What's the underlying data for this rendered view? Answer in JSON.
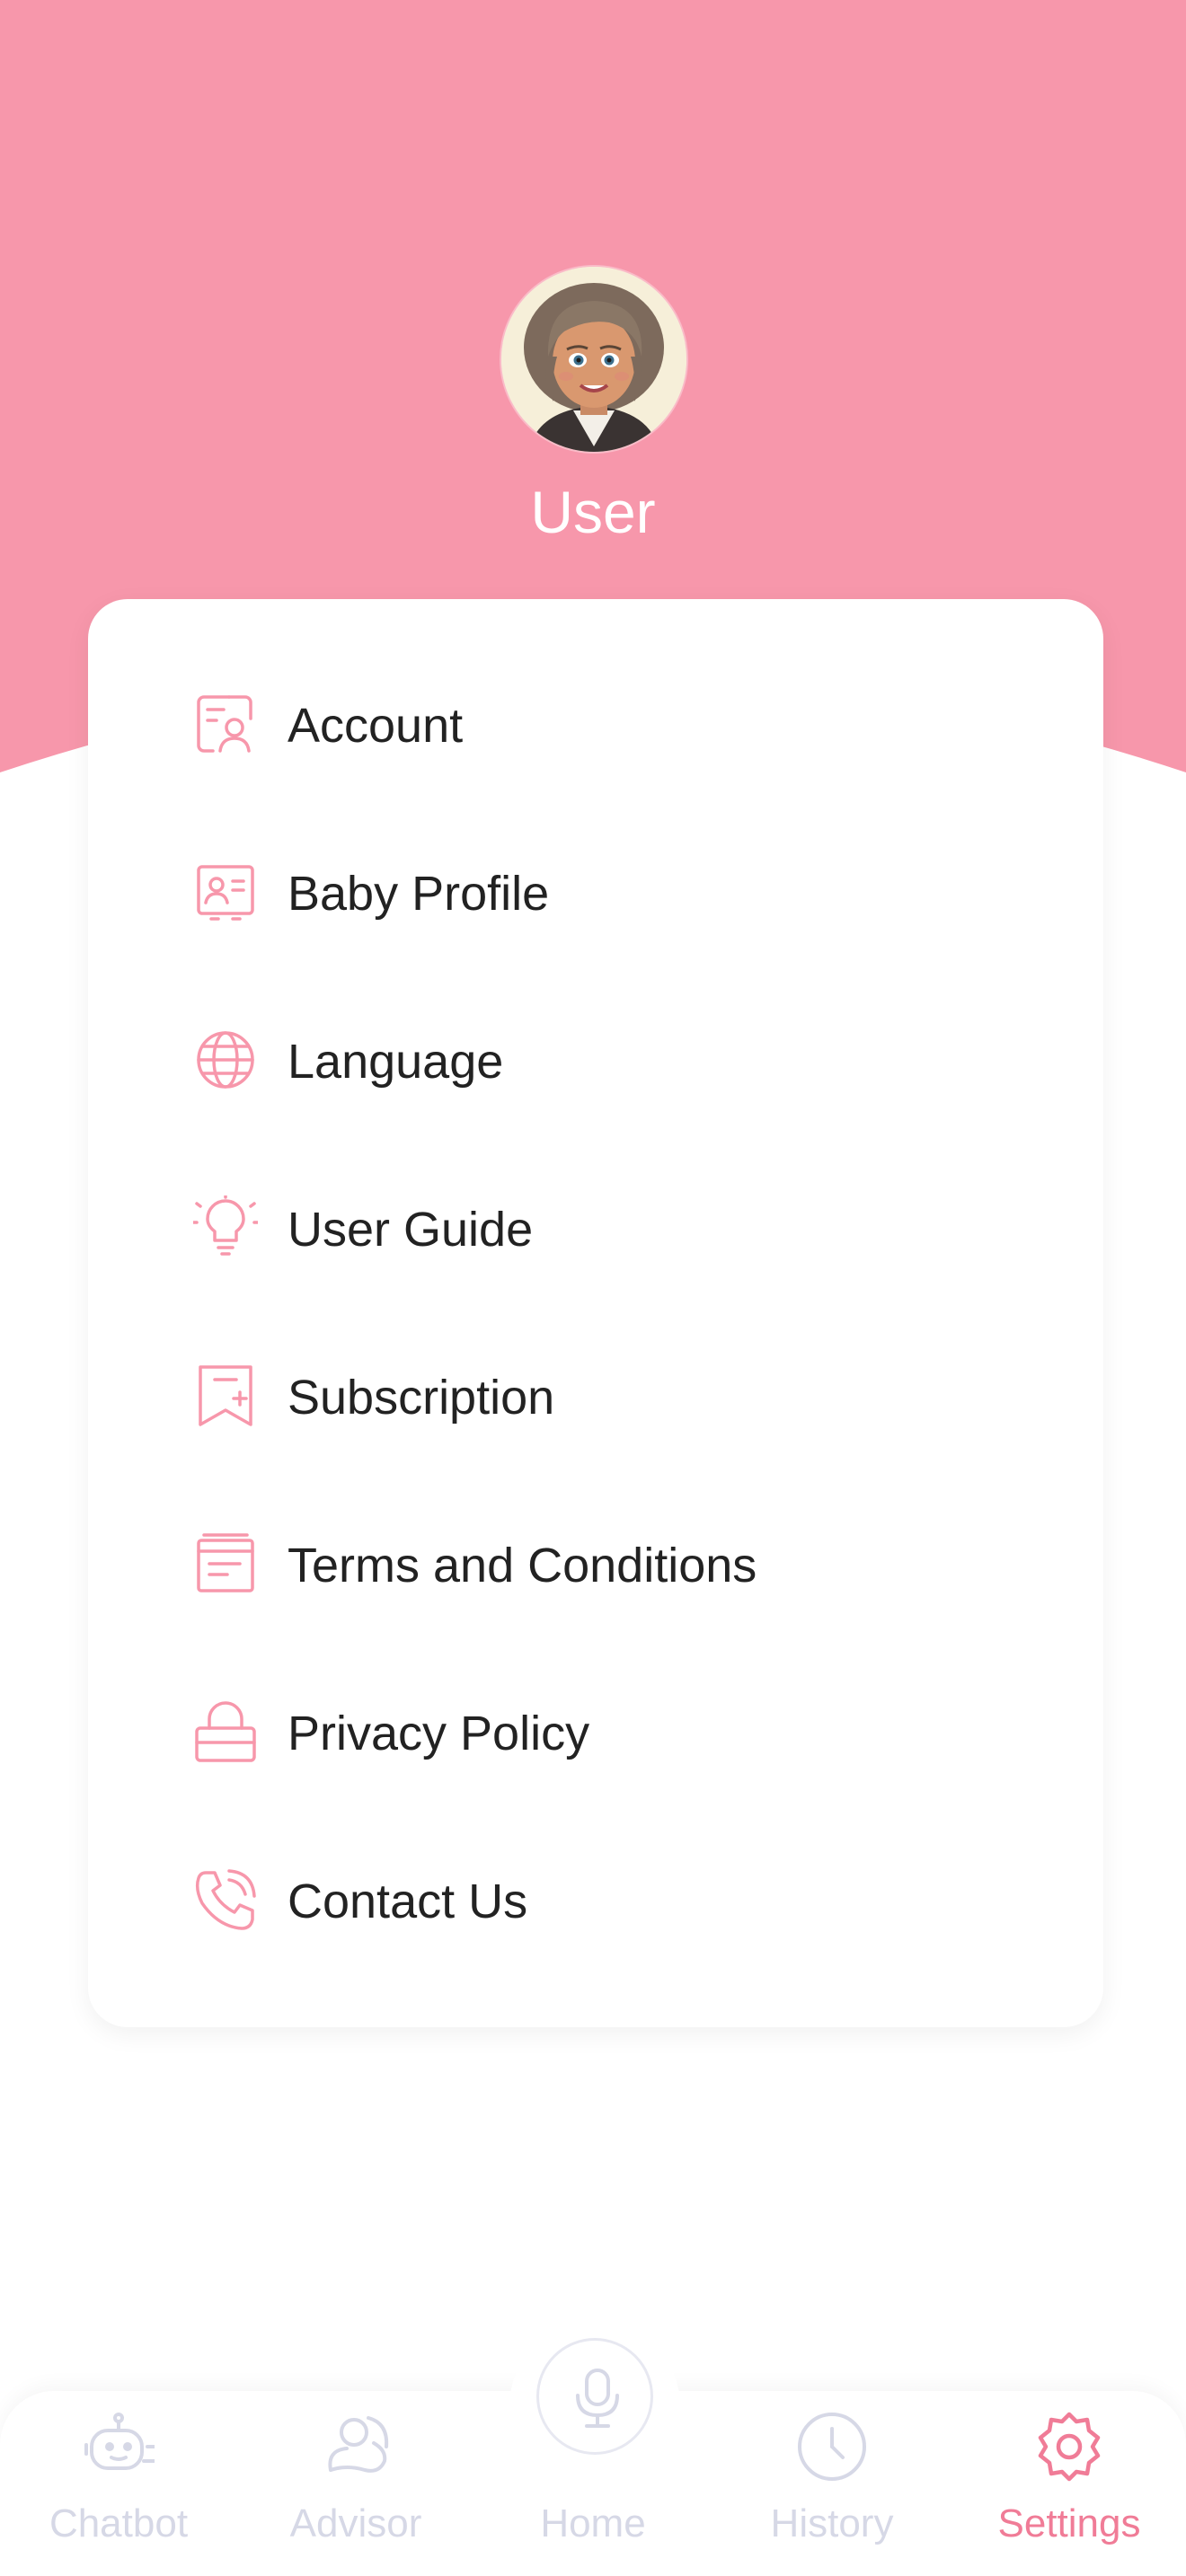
{
  "colors": {
    "accent": "#F797AB",
    "tab_inactive": "#D6D8E6",
    "tab_active": "#F07C97",
    "text": "#222222"
  },
  "profile": {
    "name": "User"
  },
  "menu": {
    "items": [
      {
        "label": "Account",
        "icon": "account-card-icon"
      },
      {
        "label": "Baby Profile",
        "icon": "profile-card-icon"
      },
      {
        "label": "Language",
        "icon": "globe-icon"
      },
      {
        "label": "User Guide",
        "icon": "lightbulb-icon"
      },
      {
        "label": "Subscription",
        "icon": "bookmark-plus-icon"
      },
      {
        "label": "Terms and Conditions",
        "icon": "document-icon"
      },
      {
        "label": "Privacy Policy",
        "icon": "lock-icon"
      },
      {
        "label": "Contact Us",
        "icon": "phone-icon"
      }
    ]
  },
  "tabbar": {
    "tabs": [
      {
        "label": "Chatbot",
        "icon": "robot-icon",
        "active": false
      },
      {
        "label": "Advisor",
        "icon": "advisor-icon",
        "active": false
      },
      {
        "label": "Home",
        "icon": "microphone-icon",
        "active": false
      },
      {
        "label": "History",
        "icon": "clock-icon",
        "active": false
      },
      {
        "label": "Settings",
        "icon": "gear-icon",
        "active": true
      }
    ]
  }
}
